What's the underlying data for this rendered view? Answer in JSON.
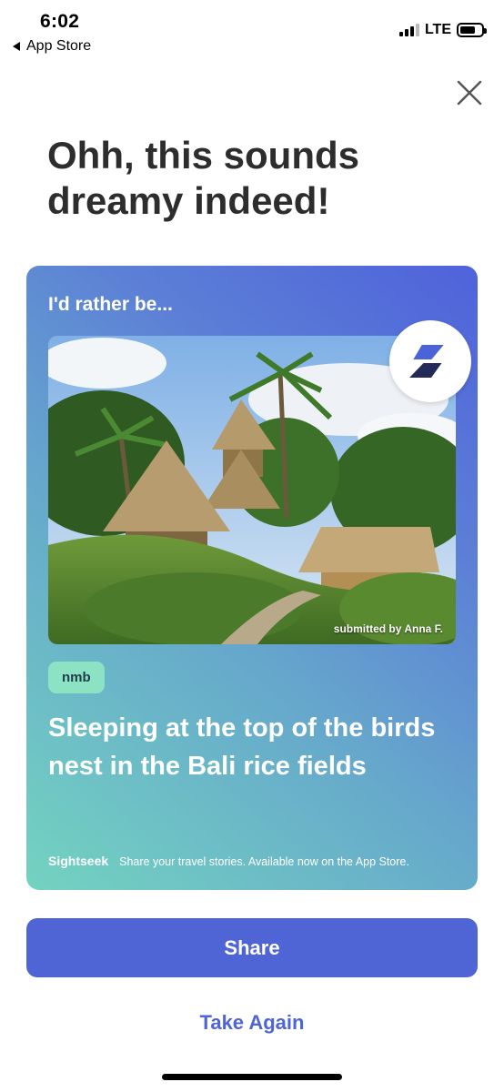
{
  "status_bar": {
    "time": "6:02",
    "back_app": "App Store",
    "network": "LTE",
    "battery_level": 0.72,
    "signal_bars": 3
  },
  "close": {
    "icon": "close-icon"
  },
  "heading": "Ohh, this sounds dreamy indeed!",
  "card": {
    "kicker": "I'd rather be...",
    "photo_credit": "submitted by Anna F.",
    "logo_icon": "sightseek-logo-icon",
    "tag": "nmb",
    "story": "Sleeping at the top of the birds nest in the Bali rice fields",
    "brand": "Sightseek",
    "promo": "Share your travel stories. Available now on the App Store."
  },
  "actions": {
    "share_label": "Share",
    "take_again_label": "Take Again"
  },
  "colors": {
    "accent": "#4f65d6",
    "tag_bg": "#8be3c3",
    "gradient_start": "#73d3c0",
    "gradient_end": "#4f62db"
  }
}
